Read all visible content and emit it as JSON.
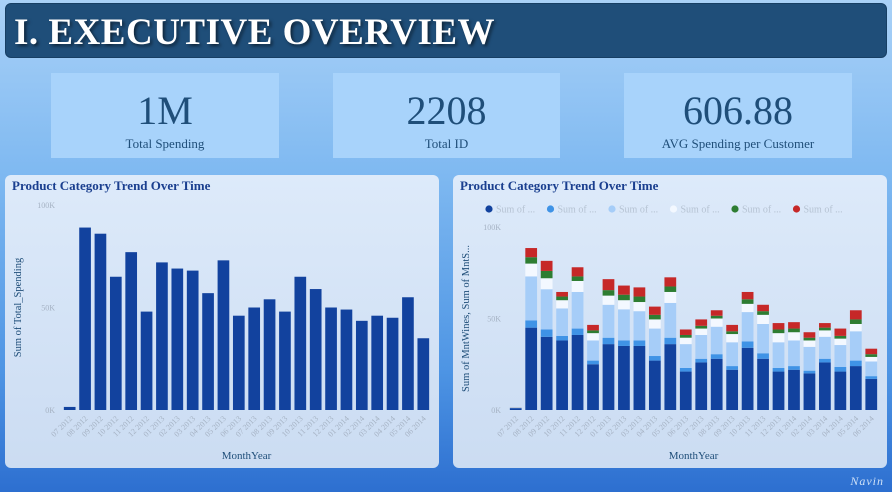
{
  "header": {
    "title": "I. EXECUTIVE OVERVIEW"
  },
  "kpis": [
    {
      "value": "1M",
      "label": "Total Spending"
    },
    {
      "value": "2208",
      "label": "Total ID"
    },
    {
      "value": "606.88",
      "label": "AVG Spending per Customer"
    }
  ],
  "months": [
    "07 2012",
    "08 2012",
    "09 2012",
    "10 2012",
    "11 2012",
    "12 2012",
    "01 2013",
    "02 2013",
    "03 2013",
    "04 2013",
    "05 2013",
    "06 2013",
    "07 2013",
    "08 2013",
    "09 2013",
    "10 2013",
    "11 2013",
    "12 2013",
    "01 2014",
    "02 2014",
    "03 2014",
    "04 2014",
    "05 2014",
    "06 2014"
  ],
  "colors": {
    "bar": "#12429e",
    "series": [
      "#12429e",
      "#3f93e6",
      "#a6cdf8",
      "#f3f8ff",
      "#2e7d32",
      "#c62828"
    ]
  },
  "chart_data": [
    {
      "type": "bar",
      "title": "Product Category Trend Over Time",
      "xlabel": "MonthYear",
      "ylabel": "Sum of Total_Spending",
      "yticks": [
        "0K",
        "50K",
        "100K"
      ],
      "ylim": [
        0,
        100000
      ],
      "categories": [
        "07 2012",
        "08 2012",
        "09 2012",
        "10 2012",
        "11 2012",
        "12 2012",
        "01 2013",
        "02 2013",
        "03 2013",
        "04 2013",
        "05 2013",
        "06 2013",
        "07 2013",
        "08 2013",
        "09 2013",
        "10 2013",
        "11 2013",
        "12 2013",
        "01 2014",
        "02 2014",
        "03 2014",
        "04 2014",
        "05 2014",
        "06 2014"
      ],
      "values": [
        1500,
        89000,
        86000,
        65000,
        77000,
        48000,
        72000,
        69000,
        68000,
        57000,
        73000,
        46000,
        50000,
        54000,
        48000,
        65000,
        59000,
        50000,
        49000,
        43500,
        46000,
        45000,
        55000,
        35000
      ]
    },
    {
      "type": "bar",
      "stacked": true,
      "title": "Product Category Trend Over Time",
      "xlabel": "MonthYear",
      "ylabel": "Sum of MntWines, Sum of MntS...",
      "yticks": [
        "0K",
        "50K",
        "100K"
      ],
      "ylim": [
        0,
        100000
      ],
      "legend_labels": [
        "Sum of ...",
        "Sum of ...",
        "Sum of ...",
        "Sum of ...",
        "Sum of ...",
        "Sum of ..."
      ],
      "legend_position": "top",
      "categories": [
        "07 2012",
        "08 2012",
        "09 2012",
        "10 2012",
        "11 2012",
        "12 2012",
        "01 2013",
        "02 2013",
        "03 2013",
        "04 2013",
        "05 2013",
        "06 2013",
        "07 2013",
        "08 2013",
        "09 2013",
        "10 2013",
        "11 2013",
        "12 2013",
        "01 2014",
        "02 2014",
        "03 2014",
        "04 2014",
        "05 2014",
        "06 2014"
      ],
      "series": [
        {
          "values": [
            1000,
            45000,
            40000,
            38000,
            41000,
            25000,
            36000,
            35000,
            35000,
            27000,
            36000,
            21000,
            26000,
            28000,
            22000,
            34000,
            28000,
            21000,
            22000,
            20000,
            26000,
            21000,
            24000,
            17000
          ]
        },
        {
          "values": [
            100,
            4000,
            4000,
            2500,
            3500,
            2000,
            3500,
            3000,
            3000,
            2500,
            3500,
            2000,
            2000,
            2500,
            2000,
            3500,
            3000,
            2000,
            2000,
            1500,
            2000,
            2500,
            3000,
            1500
          ]
        },
        {
          "values": [
            200,
            24000,
            22000,
            15000,
            20000,
            11000,
            18000,
            17000,
            16000,
            15000,
            19000,
            13000,
            13000,
            15000,
            13000,
            16000,
            16000,
            14000,
            14000,
            13000,
            12000,
            12000,
            16000,
            8000
          ]
        },
        {
          "values": [
            100,
            7000,
            6000,
            4500,
            6000,
            4000,
            5000,
            5000,
            5000,
            5000,
            6000,
            3500,
            3500,
            4500,
            4500,
            4500,
            5000,
            5000,
            4500,
            3500,
            3500,
            3500,
            4000,
            2500
          ]
        },
        {
          "values": [
            50,
            3500,
            4000,
            2000,
            2500,
            1500,
            3000,
            3000,
            3000,
            2500,
            3000,
            1500,
            1500,
            1500,
            1500,
            2500,
            2000,
            2000,
            2000,
            1500,
            1500,
            1500,
            2500,
            1500
          ]
        },
        {
          "values": [
            50,
            5000,
            5500,
            2500,
            5000,
            3000,
            6000,
            5000,
            5000,
            4500,
            5000,
            3000,
            3500,
            3000,
            3500,
            4000,
            3500,
            3500,
            3500,
            3000,
            2500,
            4000,
            5000,
            3000
          ]
        }
      ]
    }
  ],
  "footer": {
    "signature": "Navin"
  }
}
